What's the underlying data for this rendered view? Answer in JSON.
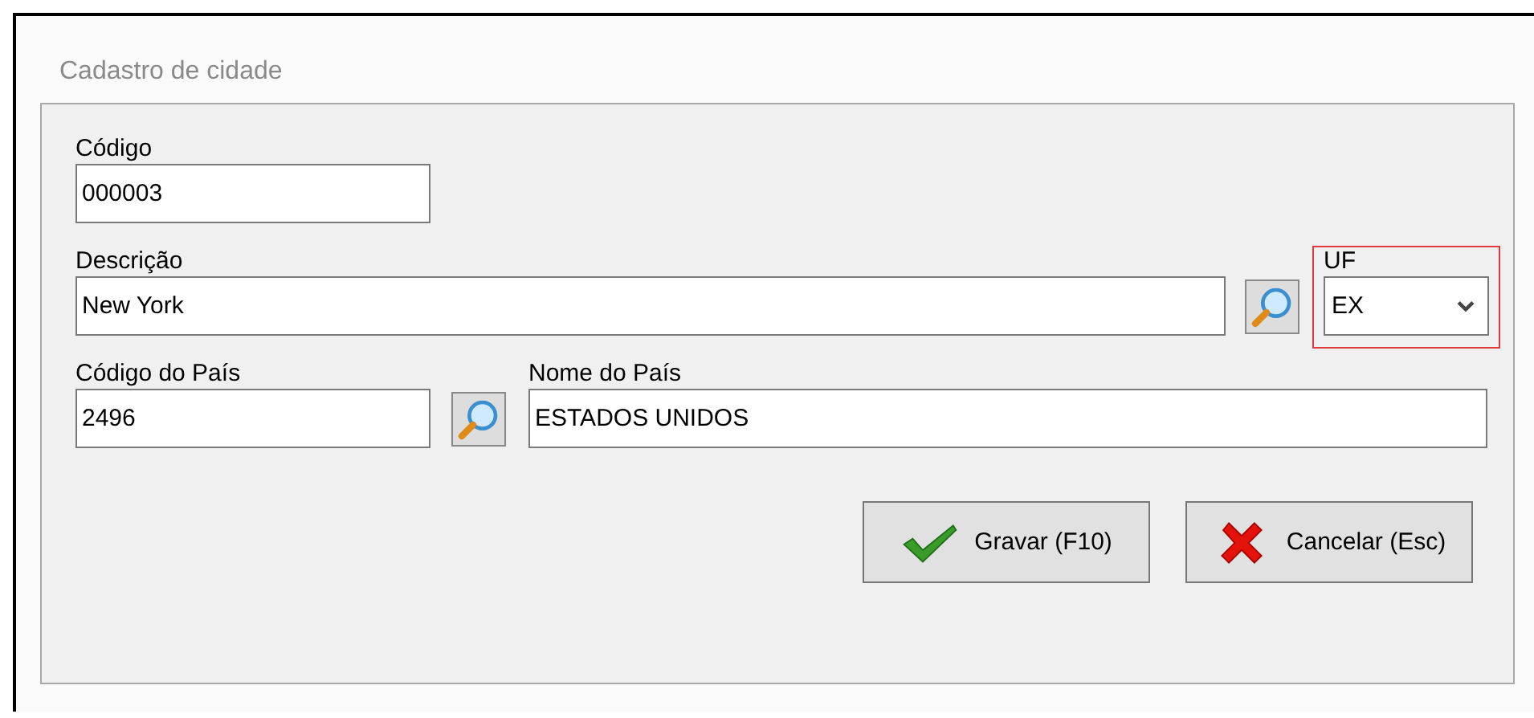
{
  "window": {
    "title": "Cadastro de cidade"
  },
  "fields": {
    "codigo": {
      "label": "Código",
      "value": "000003"
    },
    "descricao": {
      "label": "Descrição",
      "value": "New York"
    },
    "uf": {
      "label": "UF",
      "value": "EX",
      "highlighted": true
    },
    "codigo_pais": {
      "label": "Código do País",
      "value": "2496"
    },
    "nome_pais": {
      "label": "Nome do País",
      "value": "ESTADOS UNIDOS"
    }
  },
  "buttons": [
    {
      "kind": "save",
      "label": "Gravar (F10)"
    },
    {
      "kind": "cancel",
      "label": "Cancelar (Esc)"
    }
  ]
}
